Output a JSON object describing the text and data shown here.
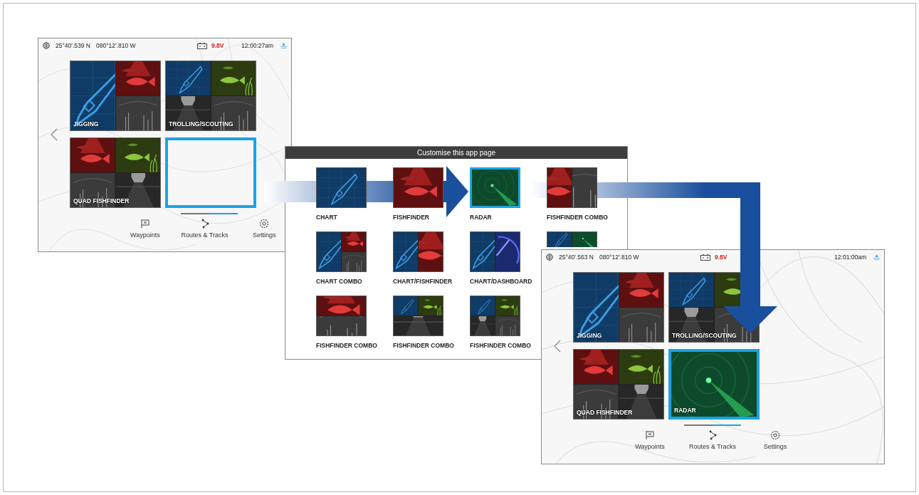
{
  "screens": [
    {
      "status_bar": {
        "latitude": "25°40'.539 N",
        "longitude": "080°12'.810 W",
        "voltage": "9.8V",
        "time": "12:00:27am"
      },
      "tiles": [
        {
          "label": "JIGGING",
          "selected": false,
          "kind": "left-main",
          "panes": [
            {
              "kind": "chart"
            },
            {
              "kind": "fishfinder"
            },
            {
              "kind": "sonar"
            }
          ]
        },
        {
          "label": "TROLLING/SCOUTING",
          "selected": false,
          "kind": "quad",
          "panes": [
            {
              "kind": "chart"
            },
            {
              "kind": "fishfinder-green"
            },
            {
              "kind": "downvision"
            },
            {
              "kind": "sonar"
            }
          ]
        },
        {
          "label": "QUAD FISHFINDER",
          "selected": false,
          "kind": "quad",
          "panes": [
            {
              "kind": "fishfinder"
            },
            {
              "kind": "fishfinder-green"
            },
            {
              "kind": "sonar"
            },
            {
              "kind": "downvision"
            }
          ]
        },
        {
          "selected": true,
          "kind": "empty"
        }
      ],
      "nav": [
        {
          "label": "Waypoints",
          "kind": "waypoints"
        },
        {
          "label": "Routes & Tracks",
          "kind": "routes"
        },
        {
          "label": "Settings",
          "kind": "settings"
        }
      ]
    },
    {
      "status_bar": {
        "latitude": "25°40'.563 N",
        "longitude": "080°12'.810 W",
        "voltage": "9.8V",
        "time": "12:01:00am"
      },
      "tiles": [
        {
          "label": "JIGGING",
          "selected": false,
          "kind": "left-main",
          "panes": [
            {
              "kind": "chart"
            },
            {
              "kind": "fishfinder"
            },
            {
              "kind": "sonar"
            }
          ]
        },
        {
          "label": "TROLLING/SCOUTING",
          "selected": false,
          "kind": "quad",
          "panes": [
            {
              "kind": "chart"
            },
            {
              "kind": "fishfinder-green"
            },
            {
              "kind": "downvision"
            },
            {
              "kind": "sonar"
            }
          ]
        },
        {
          "label": "QUAD FISHFINDER",
          "selected": false,
          "kind": "quad",
          "panes": [
            {
              "kind": "fishfinder"
            },
            {
              "kind": "fishfinder-green"
            },
            {
              "kind": "sonar"
            },
            {
              "kind": "downvision"
            }
          ]
        },
        {
          "label": "RADAR",
          "selected": true,
          "kind": "single",
          "panes": [
            {
              "kind": "radar"
            }
          ]
        }
      ],
      "nav": [
        {
          "label": "Waypoints",
          "kind": "waypoints"
        },
        {
          "label": "Routes & Tracks",
          "kind": "routes"
        },
        {
          "label": "Settings",
          "kind": "settings"
        }
      ]
    }
  ],
  "dialog": {
    "title": "Customise this app page",
    "tiles": [
      {
        "label": "CHART",
        "selected": false,
        "kind": "single",
        "panes": [
          {
            "kind": "chart"
          }
        ]
      },
      {
        "label": "FISHFINDER",
        "selected": false,
        "kind": "single",
        "panes": [
          {
            "kind": "fishfinder"
          }
        ]
      },
      {
        "label": "RADAR",
        "selected": true,
        "kind": "single",
        "panes": [
          {
            "kind": "radar"
          }
        ]
      },
      {
        "label": "FISHFINDER COMBO",
        "selected": false,
        "kind": "columns",
        "panes": [
          {
            "kind": "fishfinder"
          },
          {
            "kind": "sonar"
          }
        ]
      },
      {
        "label": "CHART COMBO",
        "selected": false,
        "kind": "left-main",
        "panes": [
          {
            "kind": "chart"
          },
          {
            "kind": "fishfinder"
          },
          {
            "kind": "sonar"
          }
        ]
      },
      {
        "label": "CHART/FISHFINDER",
        "selected": false,
        "kind": "columns",
        "panes": [
          {
            "kind": "chart"
          },
          {
            "kind": "fishfinder"
          }
        ]
      },
      {
        "label": "CHART/DASHBOARD",
        "selected": false,
        "kind": "columns",
        "panes": [
          {
            "kind": "chart"
          },
          {
            "kind": "dashboard"
          }
        ]
      },
      {
        "selected": false,
        "kind": "columns",
        "panes": [
          {
            "kind": "chart"
          },
          {
            "kind": "radar"
          }
        ]
      },
      {
        "label": "FISHFINDER COMBO",
        "selected": false,
        "kind": "rows",
        "panes": [
          {
            "kind": "fishfinder"
          },
          {
            "kind": "sonar"
          }
        ]
      },
      {
        "label": "FISHFINDER COMBO",
        "selected": false,
        "kind": "bottom-main",
        "panes": [
          {
            "kind": "chart"
          },
          {
            "kind": "fishfinder-green"
          },
          {
            "kind": "downvision"
          }
        ]
      },
      {
        "label": "FISHFINDER COMBO",
        "selected": false,
        "kind": "quad",
        "panes": [
          {
            "kind": "chart"
          },
          {
            "kind": "fishfinder-green"
          },
          {
            "kind": "downvision"
          },
          {
            "kind": "sonar"
          }
        ]
      }
    ]
  }
}
